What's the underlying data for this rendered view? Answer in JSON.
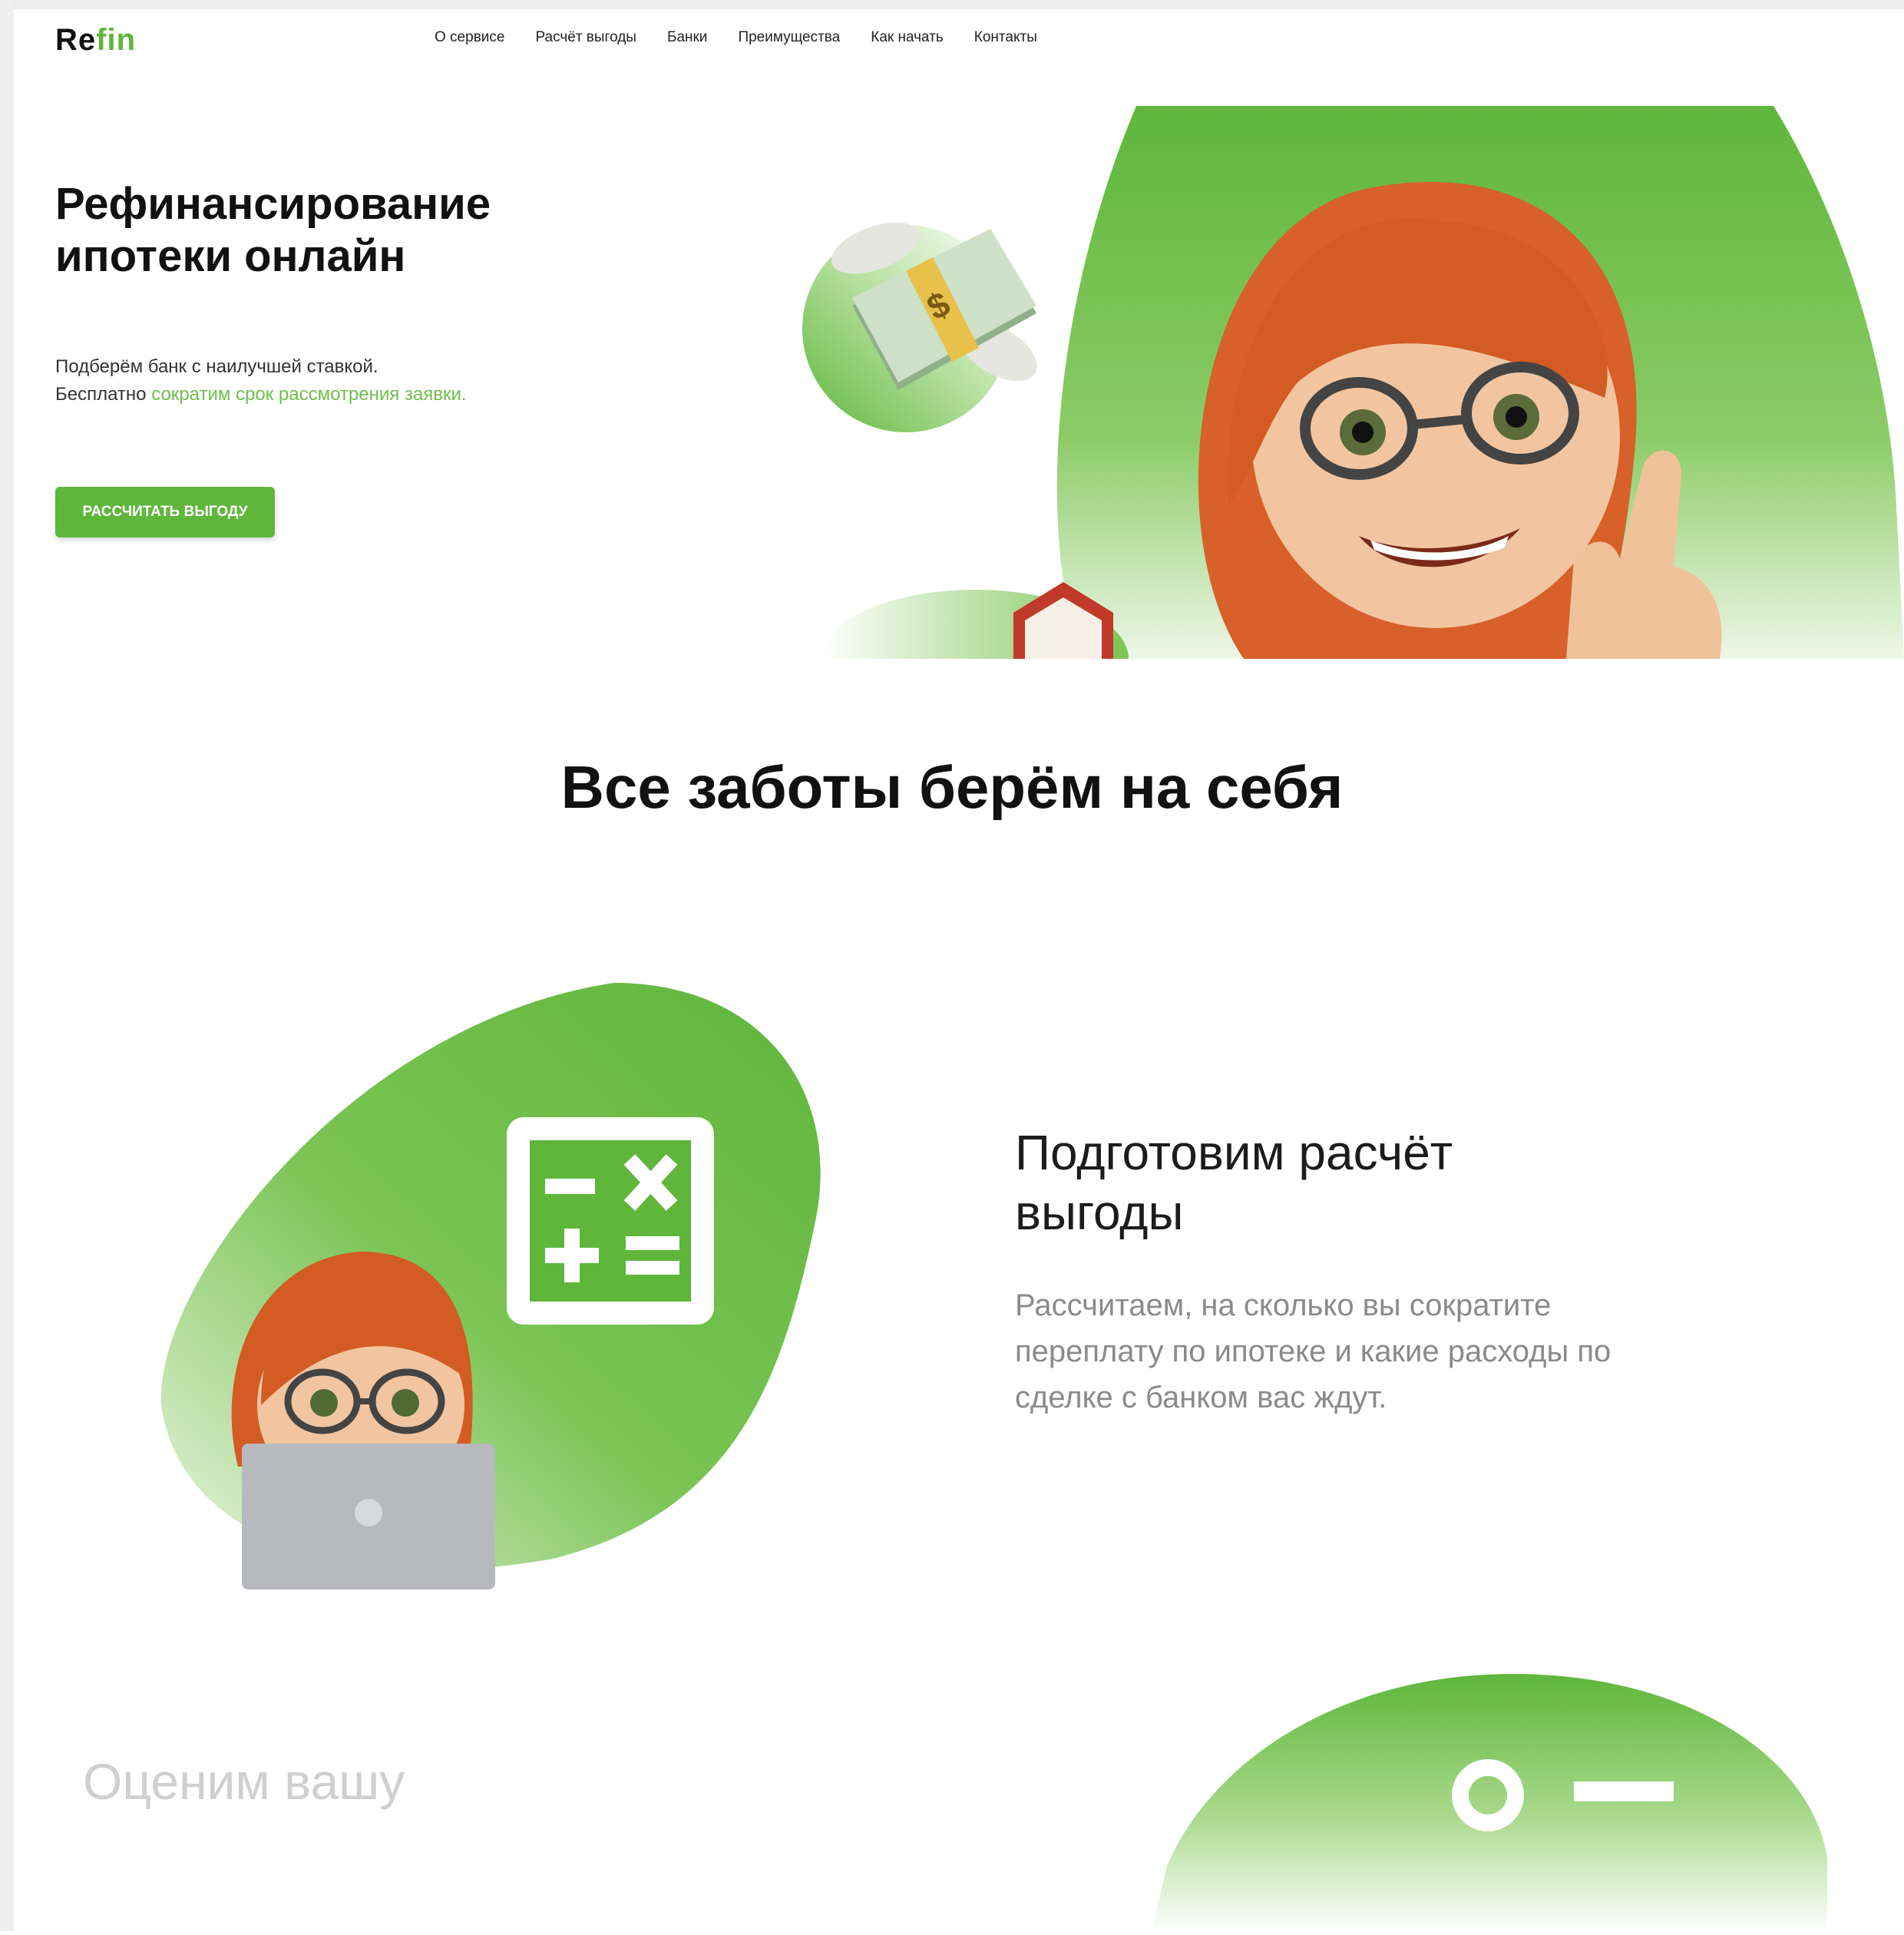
{
  "header": {
    "logo": {
      "part1": "Re",
      "part2": "fin"
    },
    "nav": [
      {
        "label": "О сервисе"
      },
      {
        "label": "Расчёт выгоды"
      },
      {
        "label": "Банки"
      },
      {
        "label": "Преимущества"
      },
      {
        "label": "Как начать"
      },
      {
        "label": "Контакты"
      }
    ]
  },
  "hero": {
    "title_line1": "Рефинансирование",
    "title_line2": "ипотеки онлайн",
    "subtitle_line1": "Подберём банк с наилучшей ставкой.",
    "subtitle_line2_plain": "Бесплатно ",
    "subtitle_line2_highlight": "сократим срок рассмотрения заявки.",
    "cta_label": "РАССЧИТАТЬ ВЫГОДУ",
    "money_symbol": "$"
  },
  "section": {
    "title": "Все заботы берём на себя",
    "feature": {
      "title_line1": "Подготовим расчёт",
      "title_line2": "выгоды",
      "description": "Рассчитаем, на сколько вы сократите переплату по ипотеке и какие расходы по сделке с банком вас ждут."
    },
    "next_title": "Оценим вашу"
  },
  "colors": {
    "accent": "#5fb63b",
    "accent_light": "#8ccc67",
    "highlight_text": "#6fbe4a"
  }
}
